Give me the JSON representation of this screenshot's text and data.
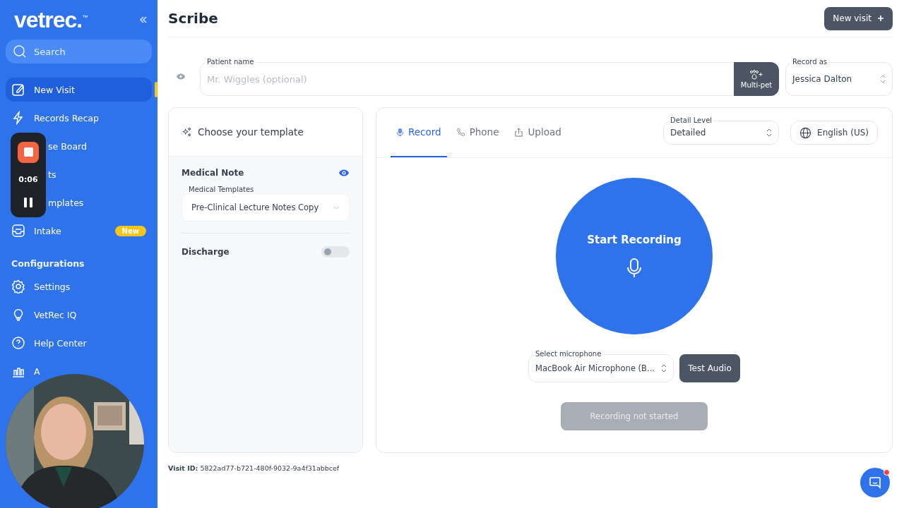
{
  "sidebar": {
    "logo": "vetrec.",
    "logo_mark": "™",
    "search": {
      "placeholder": "Search"
    },
    "items": [
      {
        "kind": "nav",
        "label": "New Visit",
        "selected": true
      },
      {
        "kind": "nav",
        "label": "Records Recap",
        "selected": false
      },
      {
        "kind": "nav",
        "label": "se Board",
        "selected": false
      },
      {
        "kind": "nav",
        "label": "ts",
        "selected": false
      },
      {
        "kind": "nav",
        "label": "mplates",
        "selected": false
      },
      {
        "kind": "nav",
        "label": "Intake",
        "selected": false,
        "badge": "New"
      },
      {
        "kind": "section",
        "label": "Configurations"
      },
      {
        "kind": "nav",
        "label": "Settings",
        "selected": false
      },
      {
        "kind": "nav",
        "label": "VetRec IQ",
        "selected": false
      },
      {
        "kind": "nav",
        "label": "Help Center",
        "selected": false
      },
      {
        "kind": "nav",
        "label": "A",
        "selected": false
      }
    ]
  },
  "recorder": {
    "time": "0:06"
  },
  "header": {
    "title": "Scribe",
    "new_visit": "New visit"
  },
  "patient": {
    "label": "Patient name",
    "placeholder": "Mr. Wiggles (optional)",
    "multi_pet": "Multi-pet",
    "record_as_label": "Record as",
    "record_as": "Jessica Dalton"
  },
  "template_card": {
    "title": "Choose your template",
    "sections": [
      {
        "kind": "select",
        "name": "Medical Note",
        "select_label": "Medical Templates",
        "value": "Pre-Clinical Lecture Notes Copy"
      },
      {
        "kind": "toggle",
        "name": "Discharge",
        "on": false
      }
    ]
  },
  "record_card": {
    "tabs": [
      {
        "label": "Record",
        "selected": true
      },
      {
        "label": "Phone",
        "selected": false
      },
      {
        "label": "Upload",
        "selected": false
      }
    ],
    "detail_label": "Detail Level",
    "detail": "Detailed",
    "language": "English (US)",
    "start": "Start Recording",
    "mic_label": "Select microphone",
    "mic": "MacBook Air Microphone (B...",
    "test_audio": "Test Audio",
    "status": "Recording not started"
  },
  "visit_id": {
    "label": "Visit ID:",
    "value": "5822ad77-b721-480f-9032-9a4f31abbcef"
  }
}
